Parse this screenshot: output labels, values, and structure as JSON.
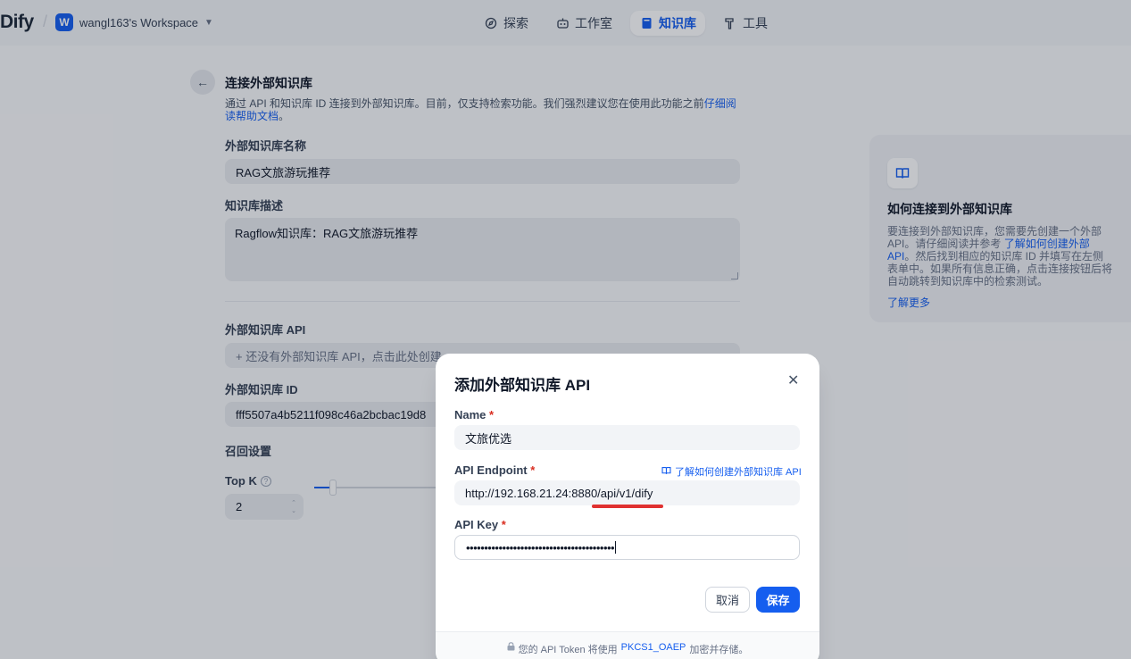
{
  "topbar": {
    "logo": "Dify",
    "workspace_initial": "W",
    "workspace_name": "wangl163's Workspace",
    "nav": [
      {
        "label": "探索",
        "icon": "compass-icon"
      },
      {
        "label": "工作室",
        "icon": "robot-icon"
      },
      {
        "label": "知识库",
        "icon": "book-icon",
        "active": true
      },
      {
        "label": "工具",
        "icon": "hammer-icon"
      }
    ]
  },
  "form": {
    "title": "连接外部知识库",
    "subtitle": "通过 API 和知识库 ID 连接到外部知识库。目前，仅支持检索功能。我们强烈建议您在使用此功能之前",
    "subtitle_link": "仔细阅读帮助文档",
    "subtitle_end": "。",
    "name_label": "外部知识库名称",
    "name_value": "RAG文旅游玩推荐",
    "desc_label": "知识库描述",
    "desc_value": "Ragflow知识库：RAG文旅游玩推荐",
    "api_label": "外部知识库 API",
    "api_placeholder": "+ 还没有外部知识库 API，点击此处创建",
    "id_label": "外部知识库 ID",
    "id_value": "fff5507a4b5211f098c46a2bcbac19d8",
    "retrieval_label": "召回设置",
    "topk_label": "Top K",
    "topk_value": "2"
  },
  "help": {
    "title": "如何连接到外部知识库",
    "text_pre": "要连接到外部知识库，您需要先创建一个外部 API。请仔细阅读并参考 ",
    "text_link": "了解如何创建外部 API",
    "text_post": "。然后找到相应的知识库 ID 并填写在左侧表单中。如果所有信息正确，点击连接按钮后将自动跳转到知识库中的检索测试。",
    "more": "了解更多"
  },
  "modal": {
    "title": "添加外部知识库 API",
    "name_label": "Name",
    "name_value": "文旅优选",
    "endpoint_label": "API Endpoint",
    "endpoint_link": "了解如何创建外部知识库 API",
    "endpoint_value": "http://192.168.21.24:8880/api/v1/dify",
    "key_label": "API Key",
    "key_value": "•••••••••••••••••••••••••••••••••••••••••",
    "cancel": "取消",
    "save": "保存",
    "footer_pre": "您的 API Token 将使用",
    "footer_link": "PKCS1_OAEP",
    "footer_post": "加密并存储。"
  },
  "colors": {
    "accent": "#155eef",
    "required": "#d92d20",
    "annotation": "#e03131"
  }
}
